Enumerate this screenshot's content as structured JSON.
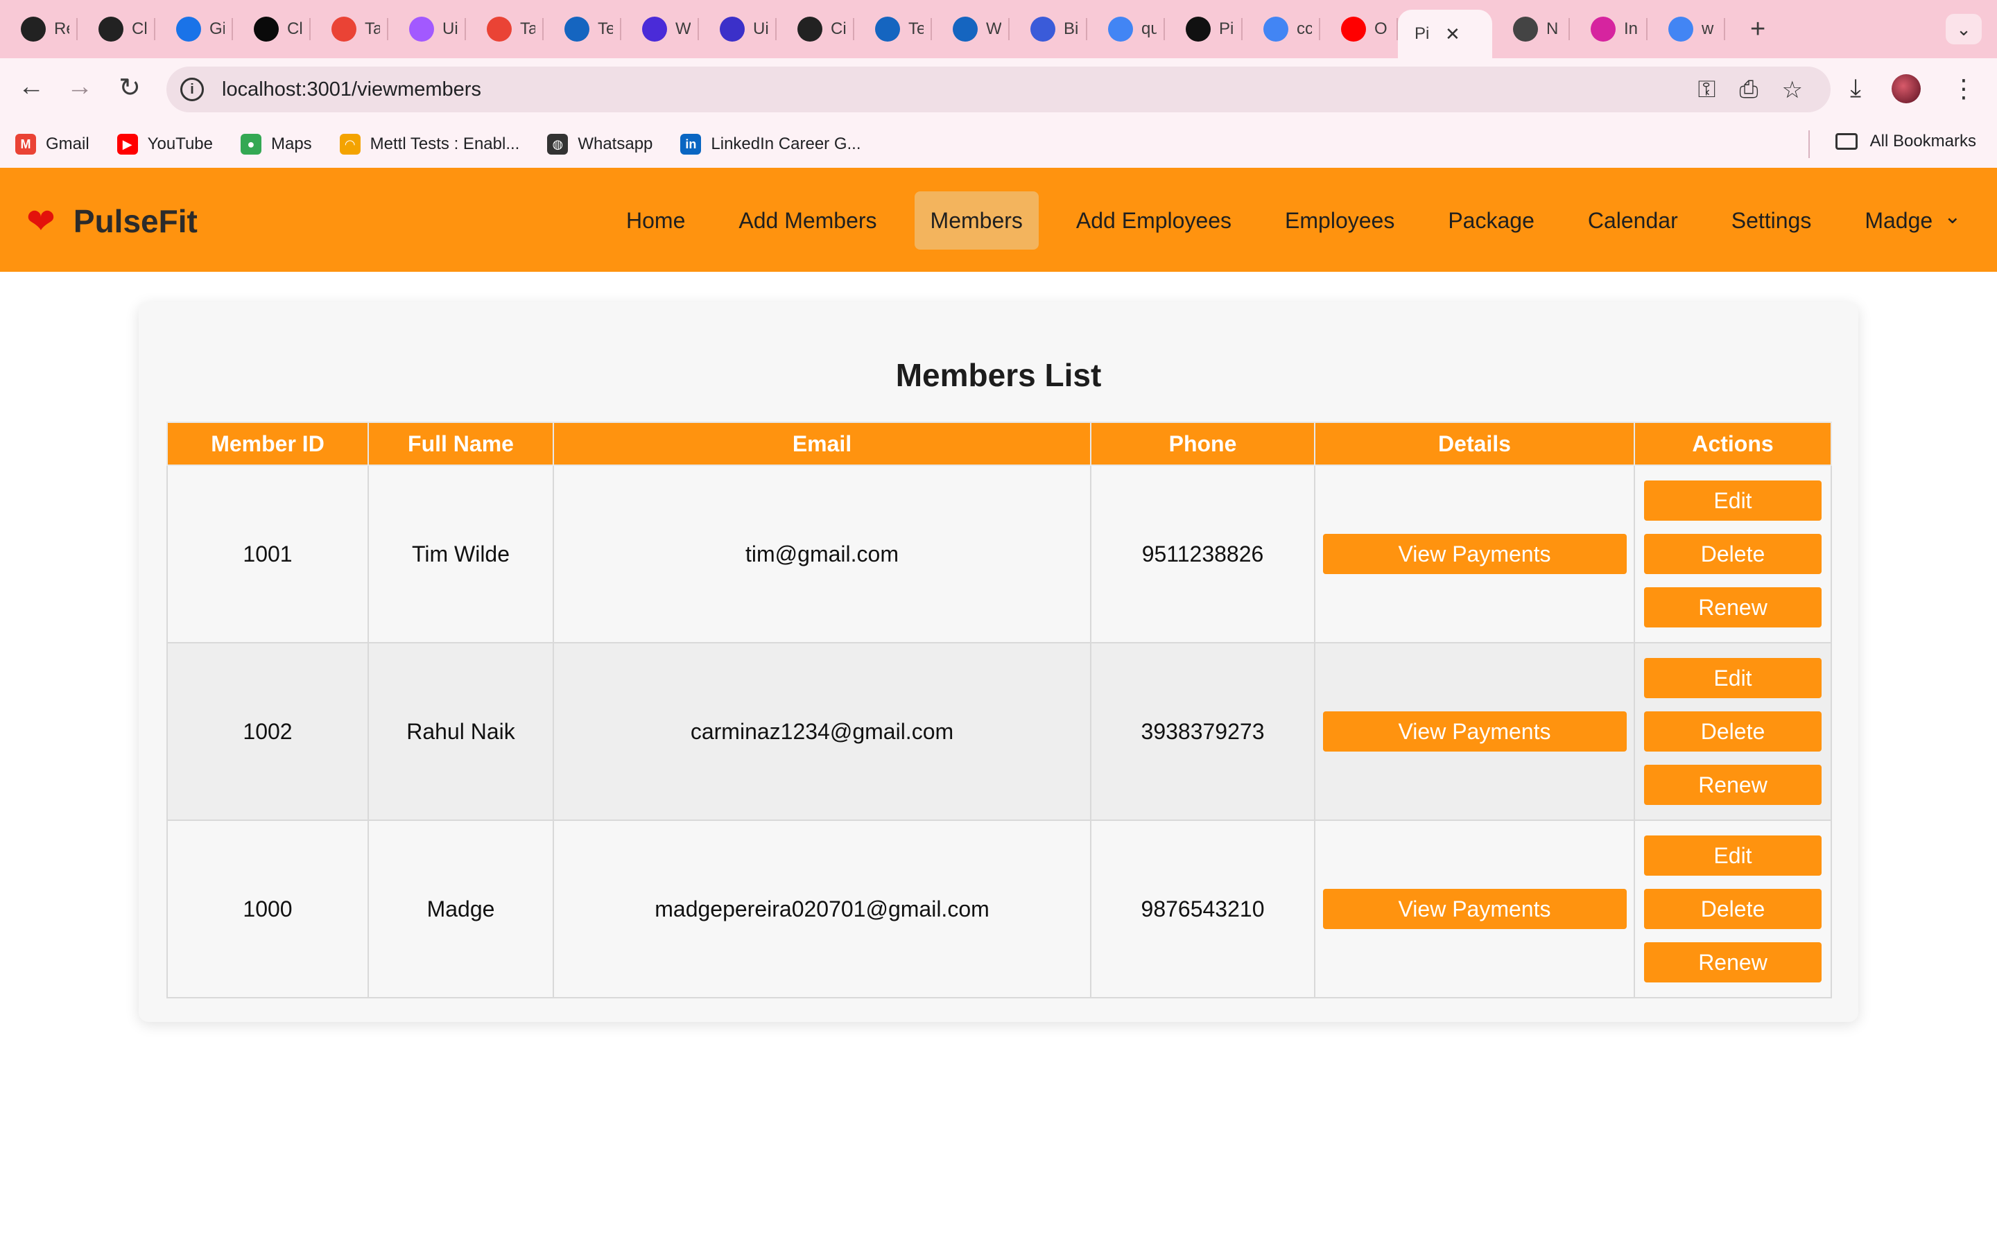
{
  "browser": {
    "tabs": [
      {
        "title": "Re",
        "icon": "react-icon",
        "color": "#222222"
      },
      {
        "title": "Cl",
        "icon": "chatgpt-icon",
        "color": "#222222"
      },
      {
        "title": "Gi",
        "icon": "calendar-icon",
        "color": "#1a73e8"
      },
      {
        "title": "Cl",
        "icon": "leaf-icon",
        "color": "#0a0a0a"
      },
      {
        "title": "Ta",
        "icon": "gmail-icon",
        "color": "#ea4335"
      },
      {
        "title": "Ui",
        "icon": "figma-icon",
        "color": "#a259ff"
      },
      {
        "title": "Ta",
        "icon": "gmail-icon",
        "color": "#ea4335"
      },
      {
        "title": "Te",
        "icon": "canva-icon",
        "color": "#1565c0"
      },
      {
        "title": "W",
        "icon": "video-icon",
        "color": "#4a2bd8"
      },
      {
        "title": "Ui",
        "icon": "app-icon",
        "color": "#3b30c9"
      },
      {
        "title": "Ci",
        "icon": "circle-logo-icon",
        "color": "#222222"
      },
      {
        "title": "Te",
        "icon": "canva-icon",
        "color": "#1565c0"
      },
      {
        "title": "W",
        "icon": "canva-icon",
        "color": "#1565c0"
      },
      {
        "title": "Bi",
        "icon": "printer-icon",
        "color": "#3a5bd9"
      },
      {
        "title": "qu",
        "icon": "google-icon",
        "color": "#4285f4"
      },
      {
        "title": "Pi",
        "icon": "github-icon",
        "color": "#111111"
      },
      {
        "title": "cc",
        "icon": "google-icon",
        "color": "#4285f4"
      },
      {
        "title": "O",
        "icon": "youtube-icon",
        "color": "#ff0000"
      }
    ],
    "active_tab": {
      "title": "Pi",
      "close": "✕"
    },
    "tabs_after": [
      {
        "title": "N",
        "icon": "chrome-icon",
        "color": "#444444"
      },
      {
        "title": "In",
        "icon": "instagram-icon",
        "color": "#d6249f"
      },
      {
        "title": "w",
        "icon": "google-icon",
        "color": "#4285f4"
      }
    ],
    "new_tab": "+",
    "tab_menu": "⌄",
    "url": "localhost:3001/viewmembers",
    "bookmarks": [
      {
        "label": "Gmail",
        "icon": "gmail-icon",
        "color": "#ea4335",
        "glyph": "M"
      },
      {
        "label": "YouTube",
        "icon": "youtube-icon",
        "color": "#ff0000",
        "glyph": "▶"
      },
      {
        "label": "Maps",
        "icon": "maps-icon",
        "color": "#34a853",
        "glyph": "●"
      },
      {
        "label": "Mettl Tests : Enabl...",
        "icon": "mettl-icon",
        "color": "#f4a300",
        "glyph": "◠"
      },
      {
        "label": "Whatsapp",
        "icon": "globe-icon",
        "color": "#333333",
        "glyph": "◍"
      },
      {
        "label": "LinkedIn Career G...",
        "icon": "linkedin-icon",
        "color": "#0a66c2",
        "glyph": "in"
      }
    ],
    "all_bookmarks": "All Bookmarks"
  },
  "app": {
    "brand": "PulseFit",
    "brand_color": "#ff930f",
    "nav": [
      "Home",
      "Add Members",
      "Members",
      "Add Employees",
      "Employees",
      "Package",
      "Calendar",
      "Settings"
    ],
    "active_nav": "Members",
    "user": "Madge"
  },
  "page": {
    "title": "Members List",
    "columns": [
      "Member ID",
      "Full Name",
      "Email",
      "Phone",
      "Details",
      "Actions"
    ],
    "rows": [
      {
        "id": "1001",
        "name": "Tim Wilde",
        "email": "tim@gmail.com",
        "phone": "9511238826"
      },
      {
        "id": "1002",
        "name": "Rahul Naik",
        "email": "carminaz1234@gmail.com",
        "phone": "3938379273"
      },
      {
        "id": "1000",
        "name": "Madge",
        "email": "madgepereira020701@gmail.com",
        "phone": "9876543210"
      }
    ],
    "details_button": "View Payments",
    "action_buttons": {
      "edit": "Edit",
      "delete": "Delete",
      "renew": "Renew"
    }
  }
}
